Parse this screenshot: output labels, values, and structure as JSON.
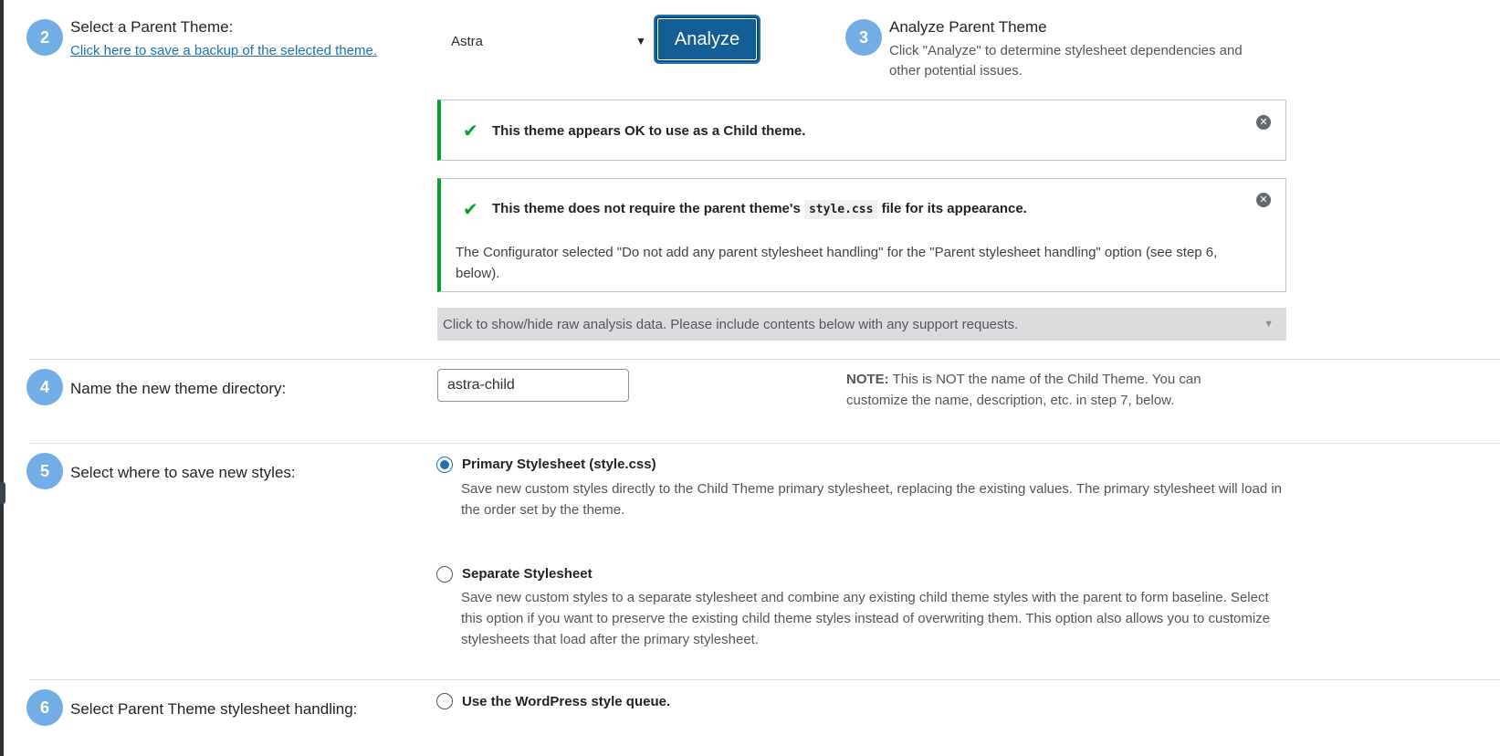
{
  "step2": {
    "number": "2",
    "label": "Select a Parent Theme:",
    "backup_link": "Click here to save a backup of the selected theme.",
    "selected_theme": "Astra",
    "analyze_button": "Analyze"
  },
  "step3": {
    "number": "3",
    "title": "Analyze Parent Theme",
    "description": "Click \"Analyze\" to determine stylesheet dependencies and other potential issues."
  },
  "notices": {
    "ok": {
      "text": "This theme appears OK to use as a Child theme."
    },
    "stylesheet": {
      "text_before": "This theme does not require the parent theme's",
      "code": "style.css",
      "text_after": "file for its appearance.",
      "body": "The Configurator selected \"Do not add any parent stylesheet handling\" for the \"Parent stylesheet handling\" option (see step 6, below)."
    }
  },
  "raw_analysis": {
    "label": "Click to show/hide raw analysis data. Please include contents below with any support requests."
  },
  "step4": {
    "number": "4",
    "label": "Name the new theme directory:",
    "value": "astra-child",
    "note_bold": "NOTE:",
    "note_text": "This is NOT the name of the Child Theme. You can customize the name, description, etc. in step 7, below."
  },
  "step5": {
    "number": "5",
    "label": "Select where to save new styles:",
    "options": [
      {
        "label": "Primary Stylesheet (style.css)",
        "description": "Save new custom styles directly to the Child Theme primary stylesheet, replacing the existing values. The primary stylesheet will load in the order set by the theme.",
        "checked": true
      },
      {
        "label": "Separate Stylesheet",
        "description": "Save new custom styles to a separate stylesheet and combine any existing child theme styles with the parent to form baseline. Select this option if you want to preserve the existing child theme styles instead of overwriting them. This option also allows you to customize stylesheets that load after the primary stylesheet.",
        "checked": false
      }
    ]
  },
  "step6": {
    "number": "6",
    "label": "Select Parent Theme stylesheet handling:",
    "options": [
      {
        "label": "Use the WordPress style queue.",
        "checked": false
      }
    ]
  },
  "colors": {
    "step_circle": "#72aee6",
    "primary_button": "#135e96",
    "success": "#00a32a",
    "link": "#2271b1"
  },
  "icons": {
    "check": "checkmark-icon",
    "dismiss": "dismiss-icon",
    "caret": "chevron-down-icon"
  }
}
